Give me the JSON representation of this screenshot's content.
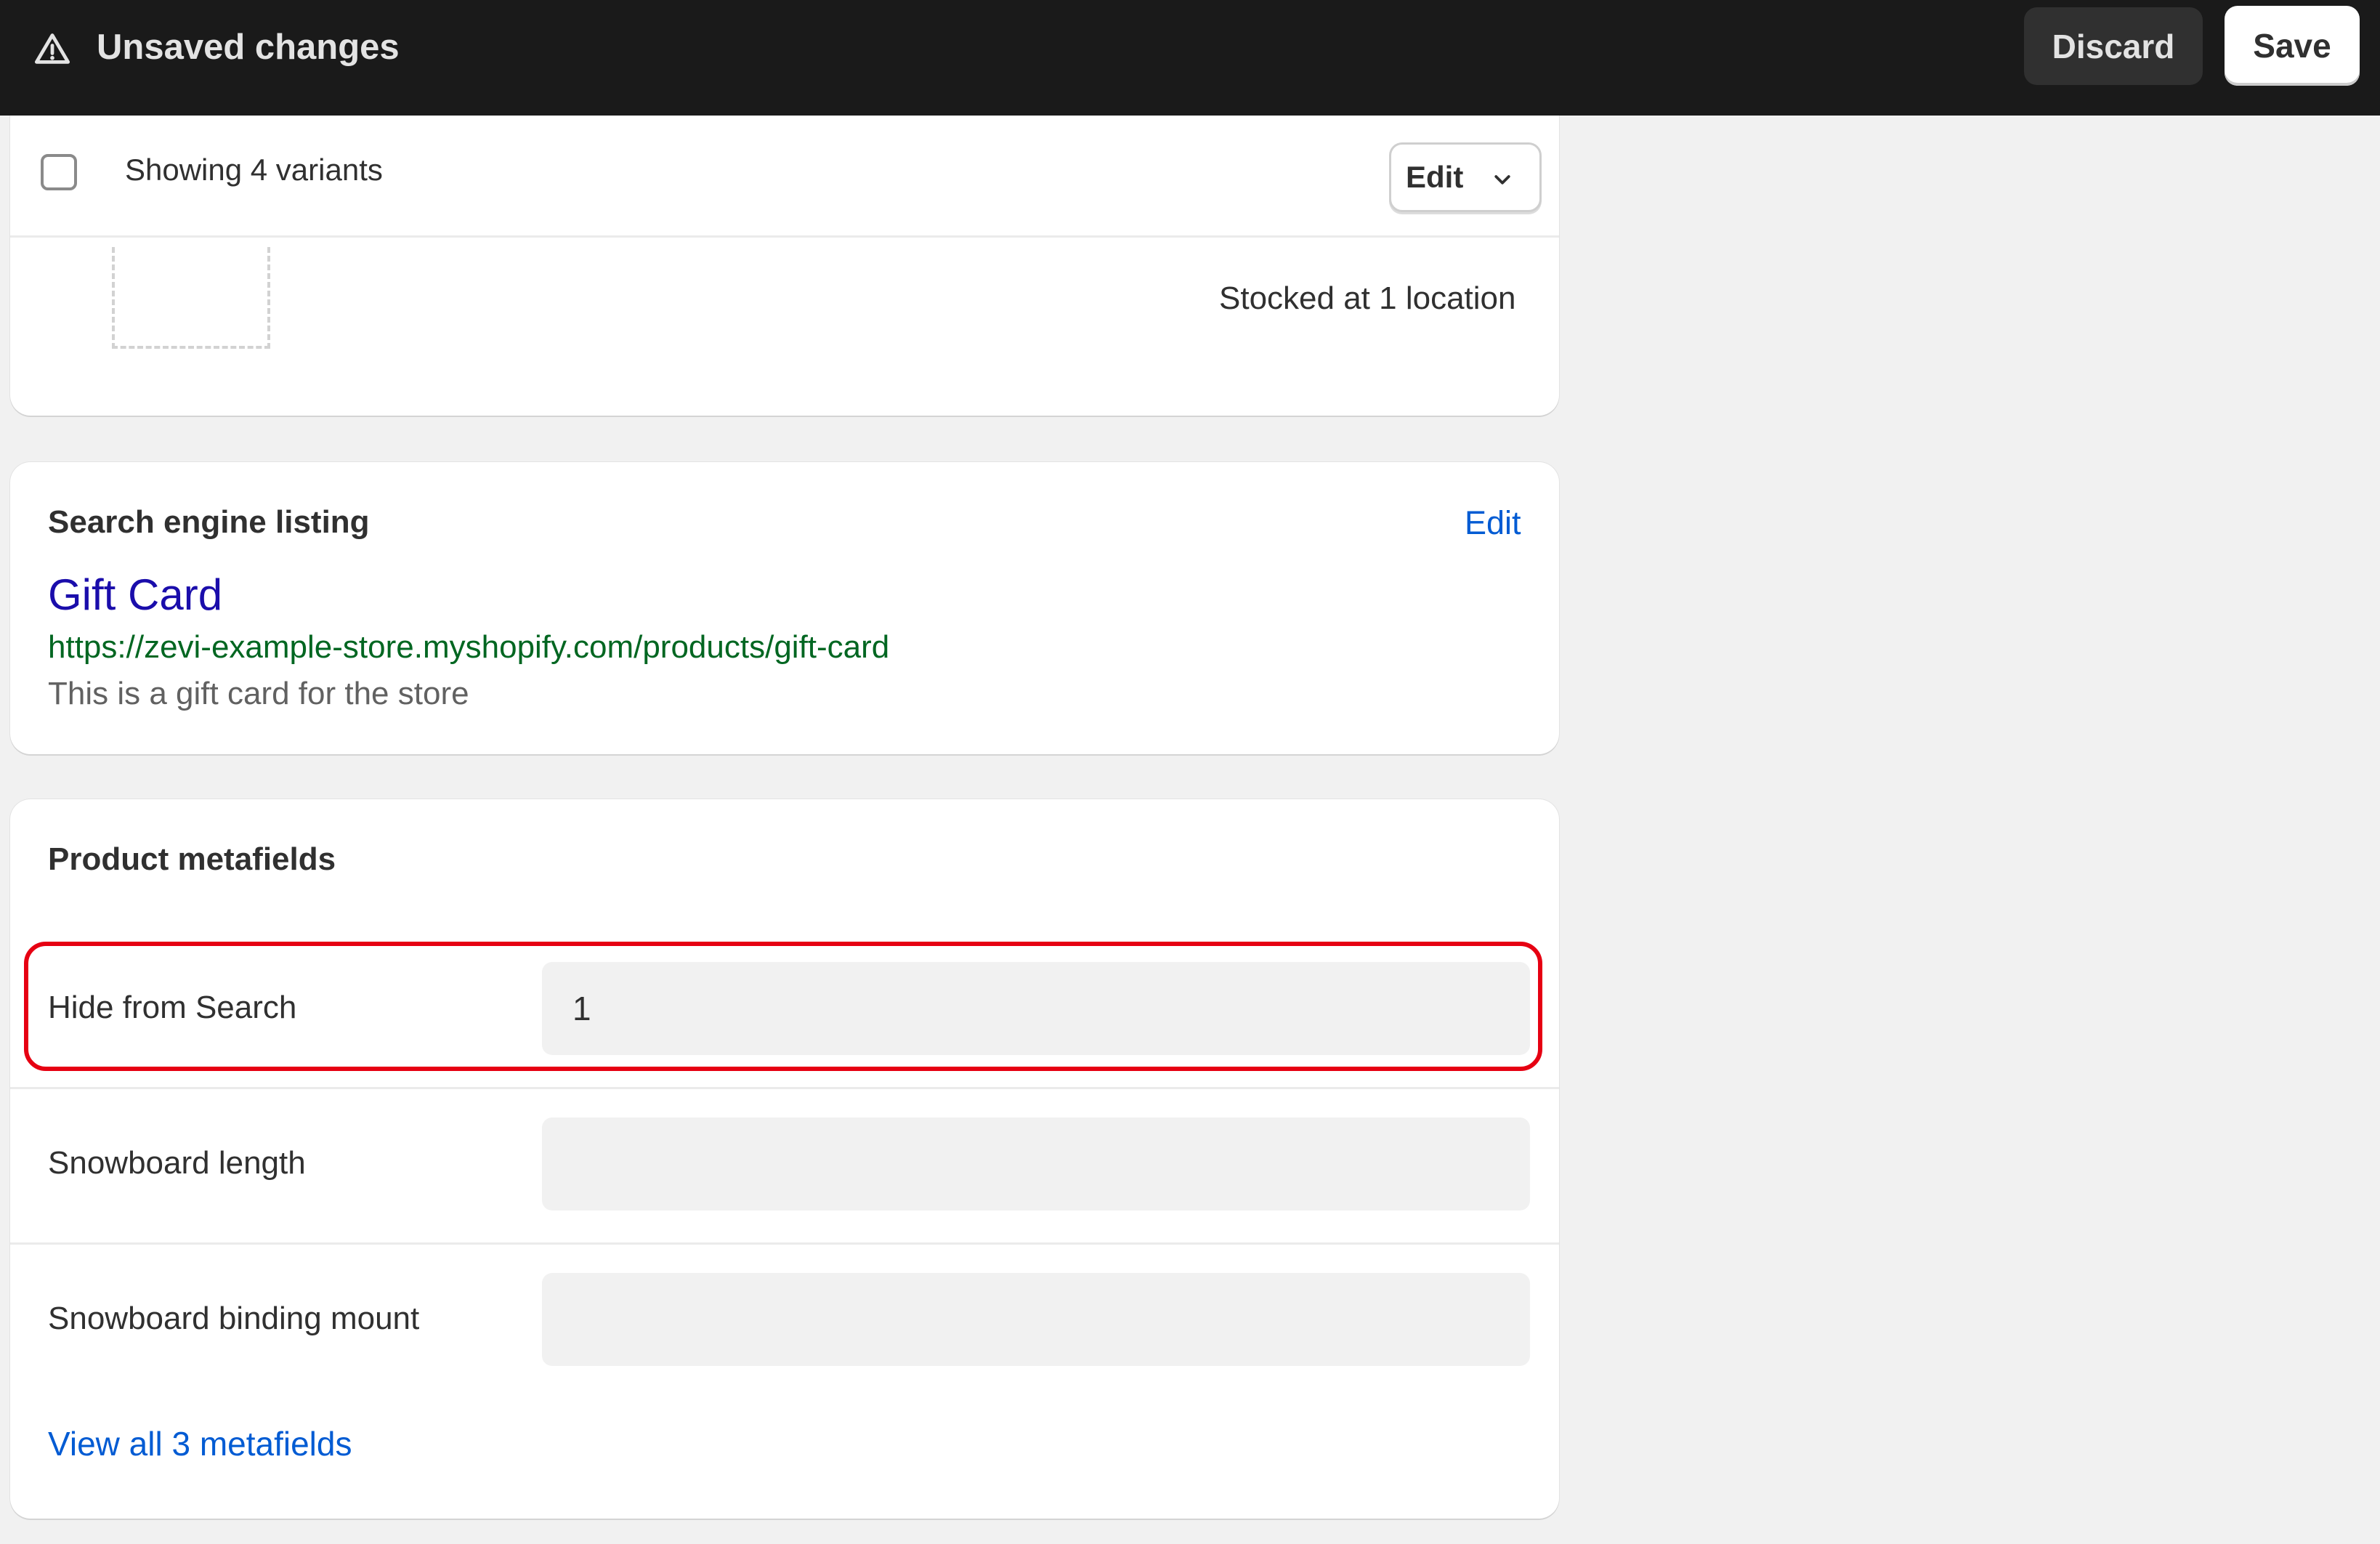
{
  "save_bar": {
    "title": "Unsaved changes",
    "icon": "warning-triangle-icon",
    "discard_label": "Discard",
    "save_label": "Save"
  },
  "variants": {
    "showing_label": "Showing 4 variants",
    "edit_label": "Edit",
    "stocked_text": "Stocked at 1 location"
  },
  "seo": {
    "heading": "Search engine listing",
    "edit_label": "Edit",
    "page_title": "Gift Card",
    "url": "https://zevi-example-store.myshopify.com/products/gift-card",
    "description": "This is a gift card for the store"
  },
  "metafields": {
    "heading": "Product metafields",
    "rows": [
      {
        "label": "Hide from Search",
        "value": "1"
      },
      {
        "label": "Snowboard length",
        "value": ""
      },
      {
        "label": "Snowboard binding mount",
        "value": ""
      }
    ],
    "view_all_label": "View all 3 metafields"
  },
  "colors": {
    "save_bar_bg": "#1a1a1a",
    "link_blue": "#005bd3",
    "seo_title": "#1a0dab",
    "seo_url": "#006621",
    "highlight": "#e60012"
  }
}
